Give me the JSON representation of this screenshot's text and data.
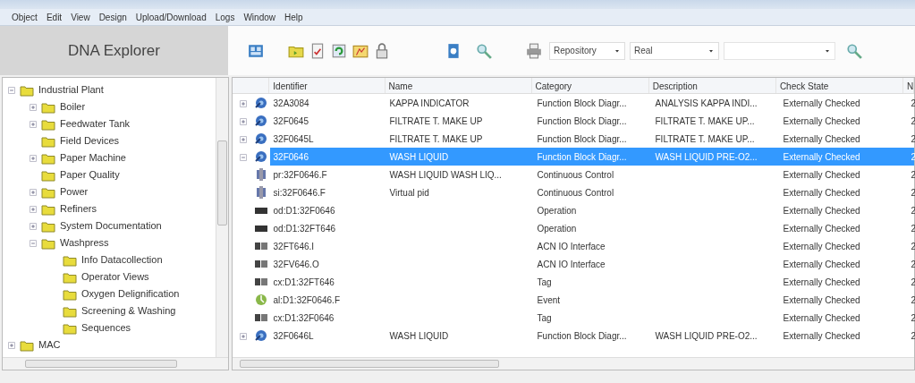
{
  "menu": [
    "Object",
    "Edit",
    "View",
    "Design",
    "Upload/Download",
    "Logs",
    "Window",
    "Help"
  ],
  "explorer_title": "DNA Explorer",
  "toolbar": {
    "combos": [
      {
        "kind": "dropdown",
        "value": "Repository"
      },
      {
        "kind": "dropdown",
        "value": "Real"
      },
      {
        "kind": "editable"
      }
    ]
  },
  "tree": [
    {
      "label": "Industrial Plant",
      "expanded": true,
      "children": [
        {
          "label": "Boiler",
          "expanded": false
        },
        {
          "label": "Feedwater Tank",
          "expanded": false
        },
        {
          "label": "Field Devices"
        },
        {
          "label": "Paper Machine",
          "expanded": false
        },
        {
          "label": "Paper Quality"
        },
        {
          "label": "Power",
          "expanded": false
        },
        {
          "label": "Refiners",
          "expanded": false
        },
        {
          "label": "System Documentation",
          "expanded": false
        },
        {
          "label": "Washpress",
          "expanded": true,
          "children": [
            {
              "label": "Info Datacollection"
            },
            {
              "label": "Operator Views"
            },
            {
              "label": "Oxygen Delignification"
            },
            {
              "label": "Screening & Washing"
            },
            {
              "label": "Sequences"
            }
          ]
        }
      ]
    },
    {
      "label": "MAC",
      "expanded": false
    }
  ],
  "table": {
    "columns": [
      "Identifier",
      "Name",
      "Category",
      "Description",
      "Check State",
      "N"
    ],
    "rows": [
      {
        "kind": "function-block",
        "expanded": false,
        "selected": false,
        "cells": [
          "32A3084",
          "KAPPA INDICATOR",
          "Function Block Diagr...",
          "ANALYSIS KAPPA INDI...",
          "Externally Checked",
          "2"
        ]
      },
      {
        "kind": "function-block",
        "expanded": false,
        "selected": false,
        "cells": [
          "32F0645",
          "FILTRATE T. MAKE UP",
          "Function Block Diagr...",
          "FILTRATE T. MAKE UP...",
          "Externally Checked",
          "2"
        ]
      },
      {
        "kind": "function-block",
        "expanded": false,
        "selected": false,
        "cells": [
          "32F0645L",
          "FILTRATE T. MAKE UP",
          "Function Block Diagr...",
          "FILTRATE T. MAKE UP...",
          "Externally Checked",
          "2"
        ]
      },
      {
        "kind": "function-block",
        "expanded": true,
        "selected": true,
        "cells": [
          "32F0646",
          "WASH LIQUID",
          "Function Block Diagr...",
          "WASH LIQUID PRE-O2...",
          "Externally Checked",
          "2"
        ]
      },
      {
        "kind": "control",
        "selected": false,
        "cells": [
          "pr:32F0646.F",
          "WASH LIQUID WASH LIQ...",
          "Continuous Control",
          "",
          "Externally Checked",
          "2"
        ]
      },
      {
        "kind": "control",
        "selected": false,
        "cells": [
          "si:32F0646.F",
          "Virtual pid",
          "Continuous Control",
          "",
          "Externally Checked",
          "2"
        ]
      },
      {
        "kind": "operation",
        "selected": false,
        "cells": [
          "od:D1:32F0646",
          "",
          "Operation",
          "",
          "Externally Checked",
          "2"
        ]
      },
      {
        "kind": "operation",
        "selected": false,
        "cells": [
          "od:D1:32FT646",
          "",
          "Operation",
          "",
          "Externally Checked",
          "2"
        ]
      },
      {
        "kind": "tag",
        "selected": false,
        "cells": [
          "32FT646.I",
          "",
          "ACN IO Interface",
          "",
          "Externally Checked",
          "2"
        ]
      },
      {
        "kind": "tag",
        "selected": false,
        "cells": [
          "32FV646.O",
          "",
          "ACN IO Interface",
          "",
          "Externally Checked",
          "2"
        ]
      },
      {
        "kind": "tag",
        "selected": false,
        "cells": [
          "cx:D1:32FT646",
          "",
          "Tag",
          "",
          "Externally Checked",
          "2"
        ]
      },
      {
        "kind": "event",
        "selected": false,
        "cells": [
          "al:D1:32F0646.F",
          "",
          "Event",
          "",
          "Externally Checked",
          "2"
        ]
      },
      {
        "kind": "tag",
        "selected": false,
        "cells": [
          "cx:D1:32F0646",
          "",
          "Tag",
          "",
          "Externally Checked",
          "2"
        ]
      },
      {
        "kind": "function-block",
        "expanded": false,
        "selected": false,
        "cells": [
          "32F0646L",
          "WASH LIQUID",
          "Function Block Diagr...",
          "WASH LIQUID PRE-O2...",
          "Externally Checked",
          "2"
        ]
      }
    ]
  }
}
